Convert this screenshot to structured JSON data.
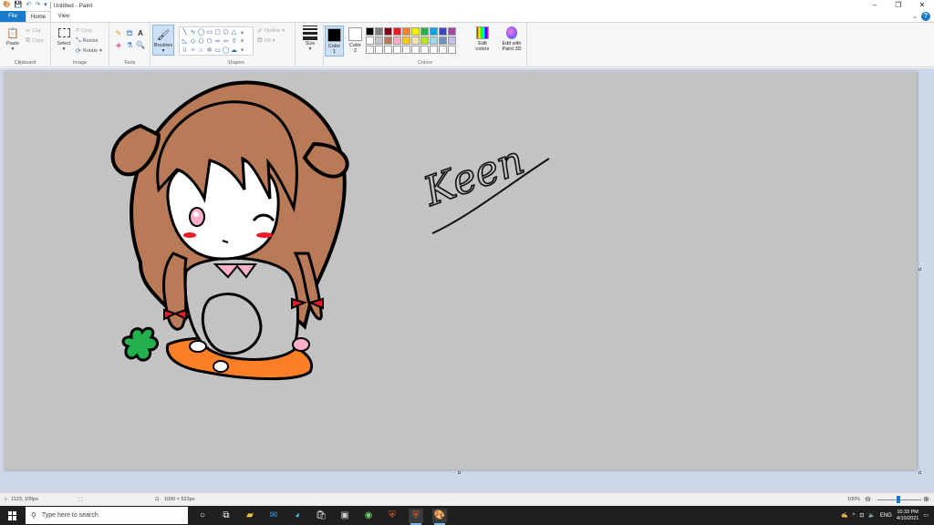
{
  "window": {
    "title": "Untitled - Paint",
    "controls": {
      "minimize": "–",
      "maximize": "❐",
      "close": "✕"
    }
  },
  "tabs": [
    {
      "label": "File"
    },
    {
      "label": "Home"
    },
    {
      "label": "View"
    }
  ],
  "ribbon": {
    "clipboard": {
      "paste": "Paste",
      "cut": "Cut",
      "copy": "Copy",
      "label": "Clipboard"
    },
    "image": {
      "select": "Select",
      "crop": "Crop",
      "resize": "Resize",
      "rotate": "Rotate",
      "label": "Image"
    },
    "tools": {
      "label": "Tools",
      "brushes": "Brushes"
    },
    "shapes": {
      "outline": "Outline",
      "fill": "Fill",
      "label": "Shapes"
    },
    "size": {
      "label": "Size"
    },
    "colors": {
      "color1_label": "Color\n1",
      "color2_label": "Color\n2",
      "color1": "#000000",
      "color2": "#ffffff",
      "edit_colors": "Edit\ncolors",
      "paint3d": "Edit with\nPaint 3D",
      "label": "Colors",
      "palette": [
        "#000000",
        "#7f7f7f",
        "#880015",
        "#ed1c24",
        "#ff7f27",
        "#fff200",
        "#22b14c",
        "#00a2e8",
        "#3f48cc",
        "#a349a4",
        "#ffffff",
        "#c3c3c3",
        "#b97a57",
        "#ffaec9",
        "#ffc90e",
        "#efe4b0",
        "#b5e61d",
        "#99d9ea",
        "#7092be",
        "#c8bfe7",
        "#ffffff",
        "#ffffff",
        "#ffffff",
        "#ffffff",
        "#ffffff",
        "#ffffff",
        "#ffffff",
        "#ffffff",
        "#ffffff",
        "#ffffff"
      ]
    }
  },
  "canvas": {
    "background": "#c3c3c3",
    "signature": "Keen"
  },
  "statusbar": {
    "cursor_pos": "1123, 109px",
    "canvas_size": "1000 × 522px",
    "zoom": "100%"
  },
  "taskbar": {
    "search_placeholder": "Type here to search",
    "language": "ENG",
    "time": "10:33 PM",
    "date": "4/10/2021"
  }
}
